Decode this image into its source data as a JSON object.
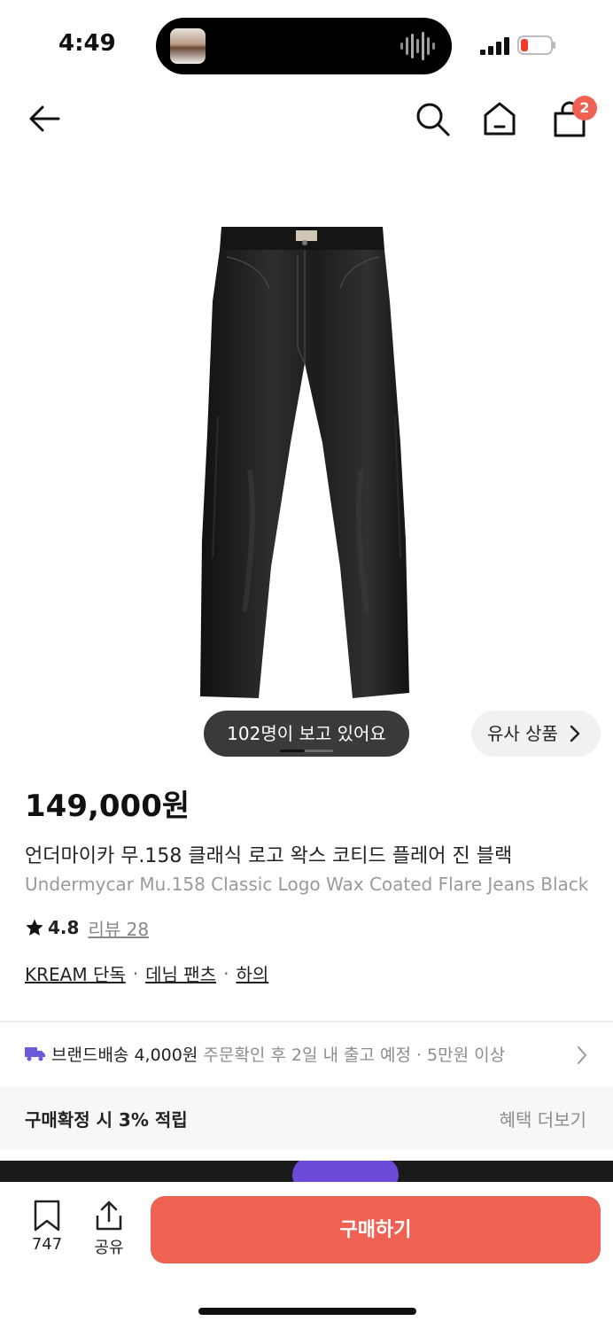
{
  "status_bar": {
    "time": "4:49"
  },
  "nav": {
    "cart_count": "2"
  },
  "gallery": {
    "viewers_text": "102명이 보고 있어요",
    "similar_label": "유사 상품"
  },
  "product": {
    "price": "149,000원",
    "name_ko": "언더마이카 무.158 클래식 로고 왁스 코티드 플레어 진 블랙",
    "name_en": "Undermycar Mu.158 Classic Logo Wax Coated Flare Jeans Black",
    "rating": "4.8",
    "review_label": "리뷰 28",
    "tags": [
      "KREAM 단독",
      "데님 팬츠",
      "하의"
    ]
  },
  "shipping": {
    "main": "브랜드배송 4,000원",
    "sub": "주문확인 후 2일 내 출고 예정 · 5만원 이상"
  },
  "benefit": {
    "text": "구매확정 시 3% 적립",
    "more": "혜택 더보기"
  },
  "bottom_bar": {
    "save_count": "747",
    "share_label": "공유",
    "buy_label": "구매하기"
  },
  "colors": {
    "accent": "#ef6253",
    "truck": "#6b5bd8"
  }
}
